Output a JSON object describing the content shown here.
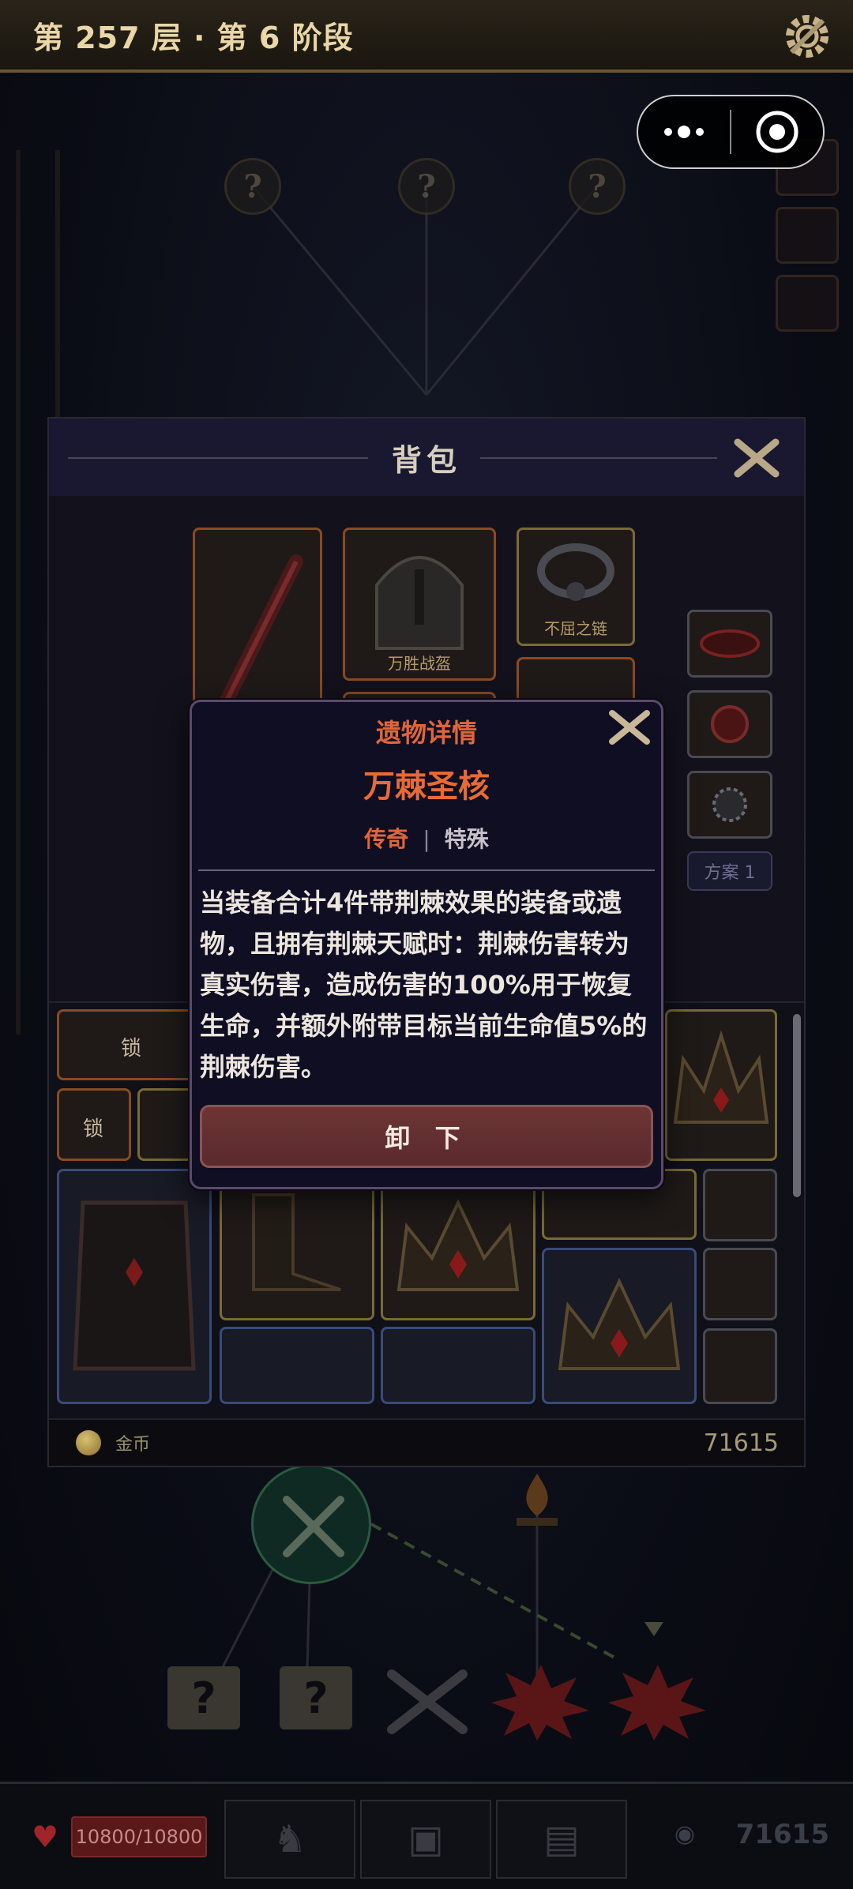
{
  "topbar": {
    "title": "第 257 层 · 第 6 阶段"
  },
  "map": {
    "unknown_glyph": "?"
  },
  "backpack": {
    "title": "背包",
    "equipped": [
      {
        "caption": "万胜战盔"
      },
      {
        "caption": "不屈之链"
      }
    ],
    "plan_label": "方案 1",
    "lock_label": "锁",
    "gold_label": "金币",
    "gold_value": "71615"
  },
  "relic": {
    "header": "遗物详情",
    "name": "万棘圣核",
    "rarity": "传奇",
    "separator": "|",
    "type": "特殊",
    "description": "当装备合计4件带荆棘效果的装备或遗物，且拥有荆棘天赋时：荆棘伤害转为真实伤害，造成伤害的100%用于恢复生命，并额外附带目标当前生命值5%的荆棘伤害。",
    "unequip_label": "卸 下"
  },
  "bottom": {
    "hp": "10800/10800",
    "gold": "71615"
  },
  "colors": {
    "accent_orange": "#e0663a",
    "unequip_red": "#6e3434",
    "panel": "#100e22"
  }
}
